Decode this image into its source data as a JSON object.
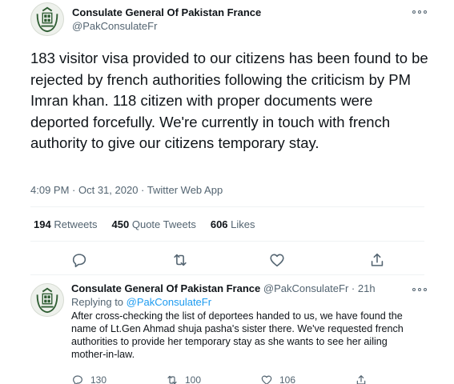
{
  "tweet": {
    "author_name": "Consulate General Of Pakistan France",
    "author_handle": "@PakConsulateFr",
    "text": "183 visitor visa provided to our citizens has been found to be rejected by french authorities following the criticism by PM Imran khan. 118 citizen with proper documents were deported forcefully. We're currently in touch with french authority to give our citizens temporary stay.",
    "time": "4:09 PM",
    "date": "Oct 31, 2020",
    "source": "Twitter Web App",
    "separator": " · ",
    "stats": {
      "retweets_count": "194",
      "retweets_label": "Retweets",
      "quotes_count": "450",
      "quotes_label": "Quote Tweets",
      "likes_count": "606",
      "likes_label": "Likes"
    }
  },
  "reply": {
    "author_name": "Consulate General Of Pakistan France",
    "author_handle": "@PakConsulateFr",
    "age": "21h",
    "replying_prefix": "Replying to ",
    "replying_to": "@PakConsulateFr",
    "text": "After cross-checking the list of deportees handed to us, we have found the name of Lt.Gen Ahmad shuja pasha's sister there. We've requested french authorities to provide her temporary stay as she wants to see her ailing mother-in-law.",
    "reply_count": "130",
    "retweet_count": "100",
    "like_count": "106"
  },
  "icons": {
    "avatar": "pakistan-emblem",
    "reply": "comment-bubble-icon",
    "retweet": "retweet-arrows-icon",
    "like": "heart-icon",
    "share": "share-upload-icon",
    "more": "more-dots-icon"
  },
  "colors": {
    "text_primary": "#0f1419",
    "text_secondary": "#536471",
    "link": "#1d9bf0",
    "divider": "#eff3f4"
  }
}
